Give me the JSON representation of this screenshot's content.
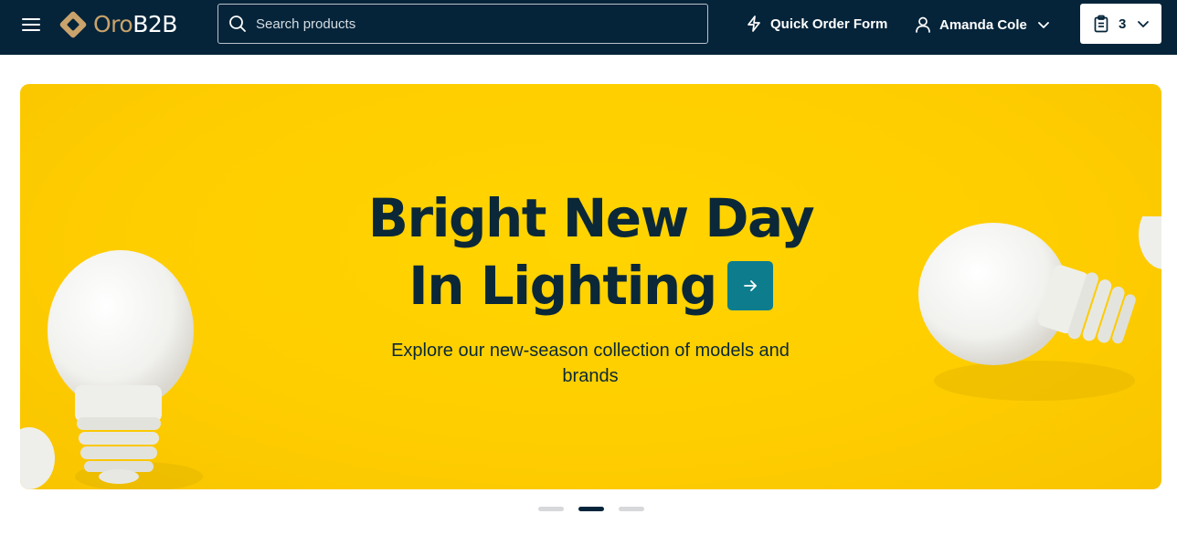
{
  "header": {
    "menu_icon": "hamburger-icon",
    "logo": {
      "oro": "Oro",
      "b2b": "B2B"
    },
    "search": {
      "placeholder": "Search products",
      "icon": "search-icon"
    },
    "quick_order": {
      "label": "Quick Order Form",
      "icon": "lightning-icon"
    },
    "user": {
      "name": "Amanda Cole",
      "icon": "user-icon"
    },
    "cart": {
      "count": "3",
      "icon": "clipboard-icon"
    },
    "colors": {
      "background": "#05243a",
      "logo_accent": "#c9a36b"
    }
  },
  "hero": {
    "title_line1": "Bright New Day",
    "title_line2": "In Lighting",
    "subtitle": "Explore our new-season collection of models and brands",
    "arrow_icon": "arrow-right-icon",
    "colors": {
      "background": "#ffd400",
      "text": "#0b2838",
      "button": "#0d7d8e"
    }
  },
  "carousel": {
    "slides": 3,
    "active_index": 1
  }
}
